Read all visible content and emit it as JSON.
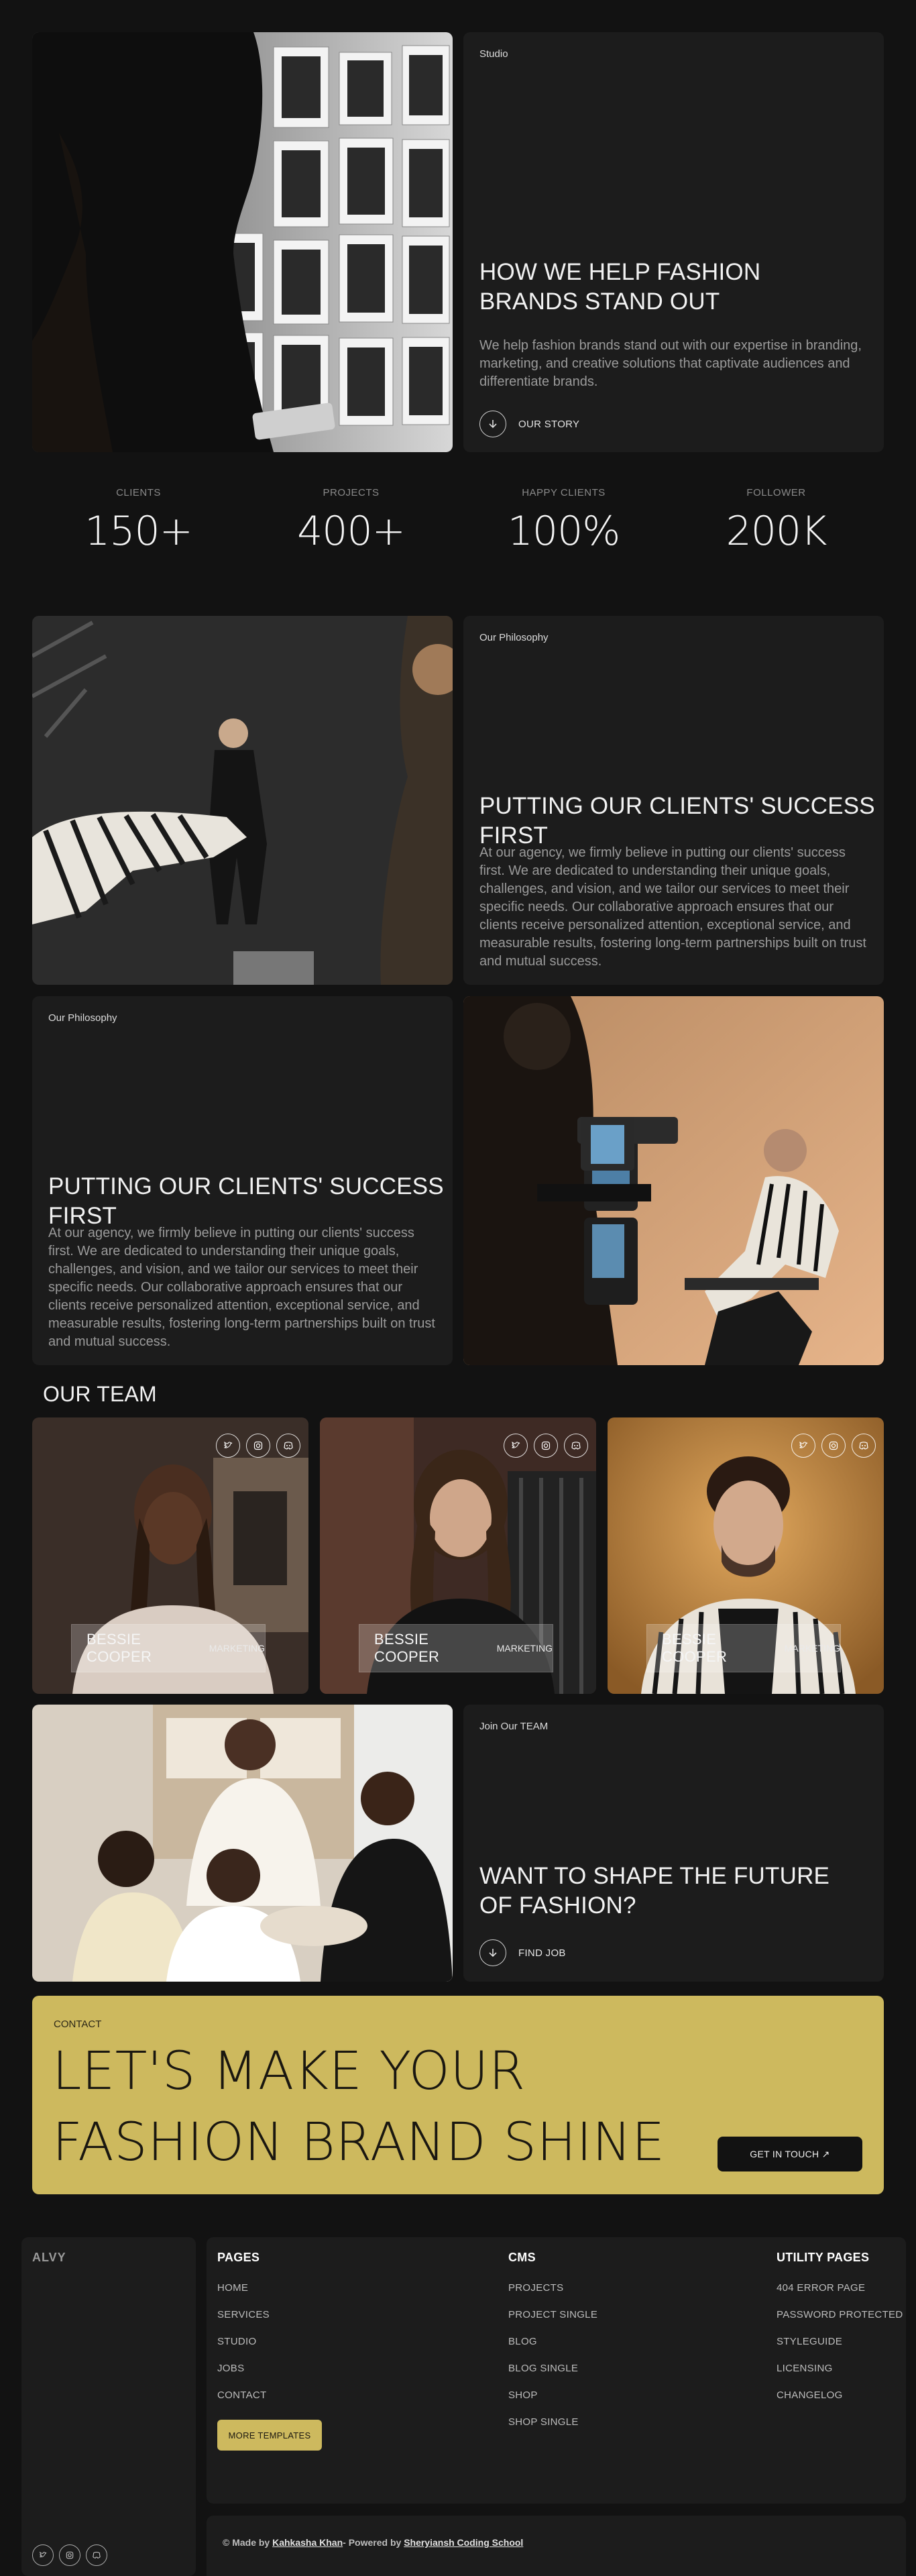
{
  "colors": {
    "background": "#121212",
    "card": "#1c1c1c",
    "accent": "#cdb95e",
    "text": "#f2f2f2",
    "muted": "#9a9a9a"
  },
  "studio": {
    "tag": "Studio",
    "title": "HOW WE HELP FASHION BRANDS STAND OUT",
    "text": "We help fashion brands stand out with our expertise in branding, marketing, and creative solutions that captivate audiences and differentiate brands.",
    "link": "OUR STORY",
    "link_icon": "arrow-down-icon",
    "image": "photographer-silhouette-photo-wall"
  },
  "stats": [
    {
      "label": "CLIENTS",
      "value": "150+"
    },
    {
      "label": "PROJECTS",
      "value": "400+"
    },
    {
      "label": "HAPPY CLIENTS",
      "value": "100%"
    },
    {
      "label": "FOLLOWER",
      "value": "200K"
    }
  ],
  "philosophy1": {
    "tag": "Our Philosophy",
    "title": "PUTTING OUR CLIENTS' SUCCESS FIRST",
    "text": "At our agency, we firmly believe in putting our clients' success first. We are dedicated to understanding their unique goals, challenges, and vision, and we tailor our services to meet their specific needs. Our collaborative approach ensures that our clients receive personalized attention, exceptional service, and measurable results, fostering long-term partnerships built on trust and mutual success.",
    "image": "model-photoshoot-studio"
  },
  "philosophy2": {
    "tag": "Our Philosophy",
    "title": "PUTTING OUR CLIENTS' SUCCESS FIRST",
    "text": "At our agency, we firmly believe in putting our clients' success first. We are dedicated to understanding their unique goals, challenges, and vision, and we tailor our services to meet their specific needs. Our collaborative approach ensures that our clients receive personalized attention, exceptional service, and measurable results, fostering long-term partnerships built on trust and mutual success.",
    "image": "camera-operator-filming-model"
  },
  "team": {
    "title": "OUR TEAM",
    "members": [
      {
        "name": "BESSIE COOPER",
        "role": "MARKETING"
      },
      {
        "name": "BESSIE COOPER",
        "role": "MARKETING"
      },
      {
        "name": "BESSIE COOPER",
        "role": "MARKETING"
      }
    ],
    "social_icons": [
      "twitter-icon",
      "instagram-icon",
      "discord-icon"
    ]
  },
  "join": {
    "tag": "Join Our TEAM",
    "title": "WANT TO SHAPE THE FUTURE OF FASHION?",
    "link": "FIND JOB",
    "image": "team-gathered-around-table"
  },
  "contact": {
    "tag": "CONTACT",
    "title": "LET'S MAKE YOUR FASHION BRAND SHINE",
    "button": "GET IN TOUCH ↗"
  },
  "footer": {
    "brand": "ALVY",
    "columns": [
      {
        "title": "PAGES",
        "items": [
          "HOME",
          "SERVICES",
          "STUDIO",
          "JOBS",
          "CONTACT"
        ]
      },
      {
        "title": "CMS",
        "items": [
          "PROJECTS",
          "PROJECT SINGLE",
          "BLOG",
          "BLOG SINGLE",
          "SHOP",
          "SHOP SINGLE"
        ]
      },
      {
        "title": "UTILITY PAGES",
        "items": [
          "404 ERROR PAGE",
          "PASSWORD PROTECTED",
          "STYLEGUIDE",
          "LICENSING",
          "CHANGELOG"
        ]
      }
    ],
    "more_button": "MORE TEMPLATES",
    "credit_prefix": "© Made by ",
    "credit_author": "Kahkasha Khan",
    "credit_middle": "- Powered by ",
    "credit_company": "Sheryiansh Coding School"
  }
}
